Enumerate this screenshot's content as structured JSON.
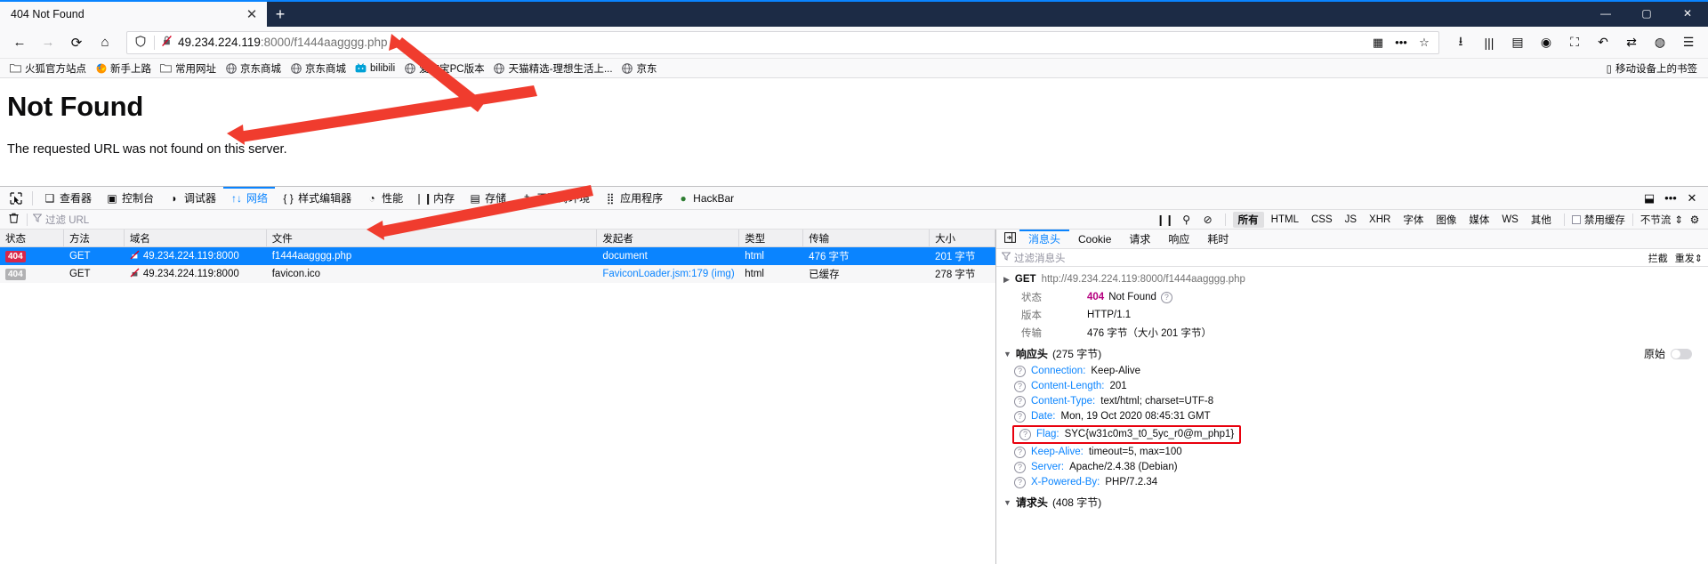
{
  "window": {
    "tab_title": "404 Not Found",
    "close_tab": "✕",
    "new_tab": "+",
    "minimize": "—",
    "maximize": "▢",
    "close": "✕"
  },
  "nav": {
    "back": "←",
    "forward": "→",
    "reload": "⟳",
    "home": "⌂",
    "url_host": "49.234.224.119",
    "url_rest": ":8000/f1444aagggg.php",
    "shield_icon": "shield-icon",
    "broken_lock_icon": "broken-lock-icon",
    "reader_icon": "▦",
    "more_icon": "•••",
    "star_icon": "☆",
    "downloads_icon": "⭳",
    "library_icon": "|||",
    "sidebar_icon": "▤",
    "account_icon": "◉",
    "extension_icon": "⛶",
    "undo_icon": "↶",
    "sync_icon": "⇄",
    "shield2_icon": "◍",
    "menu_icon": "☰"
  },
  "bookmarks": {
    "items": [
      {
        "label": "火狐官方站点",
        "icon": "folder"
      },
      {
        "label": "新手上路",
        "icon": "firefox"
      },
      {
        "label": "常用网址",
        "icon": "folder"
      },
      {
        "label": "京东商城",
        "icon": "globe"
      },
      {
        "label": "京东商城",
        "icon": "globe"
      },
      {
        "label": "bilibili",
        "icon": "bili"
      },
      {
        "label": "爱淘宝PC版本",
        "icon": "globe"
      },
      {
        "label": "天猫精选-理想生活上...",
        "icon": "globe"
      },
      {
        "label": "京东",
        "icon": "globe"
      }
    ],
    "mobile_label": "移动设备上的书签",
    "mobile_icon": "book-icon"
  },
  "page": {
    "heading": "Not Found",
    "body": "The requested URL was not found on this server."
  },
  "devtools": {
    "picker_icon": "element-picker-icon",
    "tabs": [
      {
        "label": "查看器",
        "glyph": "❑",
        "active": false
      },
      {
        "label": "控制台",
        "glyph": "▣",
        "active": false
      },
      {
        "label": "调试器",
        "glyph": "◗",
        "active": false
      },
      {
        "label": "网络",
        "glyph": "↑↓",
        "active": true
      },
      {
        "label": "样式编辑器",
        "glyph": "{ }",
        "active": false
      },
      {
        "label": "性能",
        "glyph": "◔",
        "active": false
      },
      {
        "label": "内存",
        "glyph": "❘❙",
        "active": false
      },
      {
        "label": "存储",
        "glyph": "▤",
        "active": false
      },
      {
        "label": "无障碍环境",
        "glyph": "†",
        "active": false
      },
      {
        "label": "应用程序",
        "glyph": "⣿",
        "active": false
      },
      {
        "label": "HackBar",
        "glyph": "●",
        "active": false
      }
    ],
    "right_icons": [
      "⬓",
      "•••",
      "✕"
    ],
    "filter": {
      "trash_icon": "trash-icon",
      "placeholder": "过滤 URL",
      "funnel_icon": "funnel-icon",
      "pause_icon": "❙❙",
      "search_icon": "⚲",
      "block_icon": "⊘",
      "chips": [
        "所有",
        "HTML",
        "CSS",
        "JS",
        "XHR",
        "字体",
        "图像",
        "媒体",
        "WS",
        "其他"
      ],
      "active_chip": "所有",
      "disable_cache": "禁用缓存",
      "throttle": "不节流",
      "throttle_arrow": "⇕",
      "gear_icon": "⚙"
    }
  },
  "network": {
    "columns": [
      "状态",
      "方法",
      "域名",
      "文件",
      "发起者",
      "类型",
      "传输",
      "大小"
    ],
    "rows": [
      {
        "status": "404",
        "method": "GET",
        "domain": "49.234.224.119:8000",
        "file": "f1444aagggg.php",
        "initiator": "document",
        "type": "html",
        "transfer": "476 字节",
        "size": "201 字节",
        "selected": true
      },
      {
        "status": "404",
        "method": "GET",
        "domain": "49.234.224.119:8000",
        "file": "favicon.ico",
        "initiator": "FaviconLoader.jsm:179 (img)",
        "type": "html",
        "transfer": "已缓存",
        "size": "278 字节",
        "selected": false
      }
    ]
  },
  "details": {
    "expand_icon": "▣",
    "tabs": [
      "消息头",
      "Cookie",
      "请求",
      "响应",
      "耗时"
    ],
    "active_tab": "消息头",
    "filter_placeholder": "过滤消息头",
    "block_label": "拦截",
    "reset_label": "重发",
    "reset_arrow": "⇕",
    "request_method": "GET",
    "request_url": "http://49.234.224.119:8000/f1444aagggg.php",
    "summary": [
      {
        "key": "状态",
        "value": "404 Not Found",
        "kind": "status"
      },
      {
        "key": "版本",
        "value": "HTTP/1.1",
        "kind": "plain"
      },
      {
        "key": "传输",
        "value": "476 字节（大小 201 字节）",
        "kind": "plain"
      }
    ],
    "status_code": "404",
    "status_text": "Not Found",
    "response_section_title": "响应头",
    "response_section_count": "(275 字节)",
    "raw_label": "原始",
    "response_headers": [
      {
        "name": "Connection",
        "value": "Keep-Alive",
        "flag": false
      },
      {
        "name": "Content-Length",
        "value": "201",
        "flag": false
      },
      {
        "name": "Content-Type",
        "value": "text/html; charset=UTF-8",
        "flag": false
      },
      {
        "name": "Date",
        "value": "Mon, 19 Oct 2020 08:45:31 GMT",
        "flag": false
      },
      {
        "name": "Flag",
        "value": "SYC{w31c0m3_t0_5yc_r0@m_php1}",
        "flag": true
      },
      {
        "name": "Keep-Alive",
        "value": "timeout=5, max=100",
        "flag": false
      },
      {
        "name": "Server",
        "value": "Apache/2.4.38 (Debian)",
        "flag": false
      },
      {
        "name": "X-Powered-By",
        "value": "PHP/7.2.34",
        "flag": false
      }
    ],
    "request_section_title": "请求头",
    "request_section_count": "(408 字节)"
  },
  "colors": {
    "accent": "#0a84ff",
    "status404": "#b5007f",
    "flag_box": "#e8000d",
    "arrow": "#f03c2e",
    "chrome_dark": "#1c2b45"
  }
}
